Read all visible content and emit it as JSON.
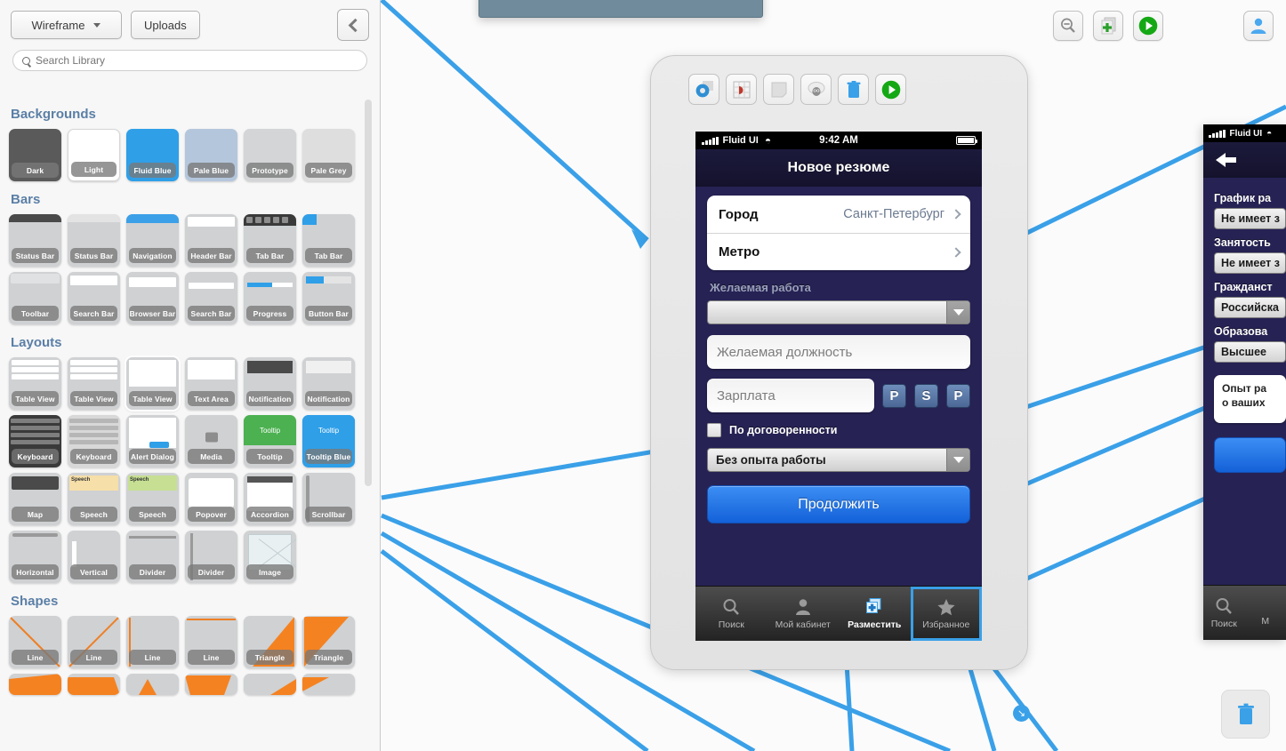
{
  "sidebar": {
    "library_button": "Wireframe",
    "uploads_button": "Uploads",
    "search_placeholder": "Search Library",
    "sections": [
      {
        "title": "Backgrounds",
        "items": [
          {
            "label": "Dark",
            "style": "dark"
          },
          {
            "label": "Light",
            "style": "white"
          },
          {
            "label": "Fluid Blue",
            "style": "blue"
          },
          {
            "label": "Pale Blue",
            "style": "paleblue"
          },
          {
            "label": "Prototype",
            "style": "proto"
          },
          {
            "label": "Pale Grey",
            "style": "palegrey"
          }
        ]
      },
      {
        "title": "Bars",
        "items": [
          {
            "label": "Status Bar",
            "style": "statusbar-dark"
          },
          {
            "label": "Status Bar",
            "style": "statusbar-light"
          },
          {
            "label": "Navigation",
            "style": "navigation"
          },
          {
            "label": "Header Bar",
            "style": "headerbar"
          },
          {
            "label": "Tab Bar",
            "style": "tabbar-dark"
          },
          {
            "label": "Tab Bar",
            "style": "tabbar-blue"
          },
          {
            "label": "Toolbar",
            "style": "toolbar"
          },
          {
            "label": "Search Bar",
            "style": "searchbar1"
          },
          {
            "label": "Browser Bar",
            "style": "browserbar"
          },
          {
            "label": "Search Bar",
            "style": "searchbar2"
          },
          {
            "label": "Progress",
            "style": "progress"
          },
          {
            "label": "Button Bar",
            "style": "buttonbar"
          }
        ]
      },
      {
        "title": "Layouts",
        "items": [
          {
            "label": "Table View",
            "style": "table1"
          },
          {
            "label": "Table View",
            "style": "table2"
          },
          {
            "label": "Table View",
            "style": "table3"
          },
          {
            "label": "Text Area",
            "style": "textarea"
          },
          {
            "label": "Notification",
            "style": "notif-dark"
          },
          {
            "label": "Notification",
            "style": "notif-light"
          },
          {
            "label": "Keyboard",
            "style": "kb-dark"
          },
          {
            "label": "Keyboard",
            "style": "kb-light"
          },
          {
            "label": "Alert Dialog",
            "style": "alert"
          },
          {
            "label": "Media",
            "style": "media"
          },
          {
            "label": "Tooltip",
            "style": "tooltip-green"
          },
          {
            "label": "Tooltip Blue",
            "style": "tooltip-blue"
          },
          {
            "label": "Map",
            "style": "map"
          },
          {
            "label": "Speech",
            "style": "speech-yellow"
          },
          {
            "label": "Speech",
            "style": "speech-green"
          },
          {
            "label": "Popover",
            "style": "popover"
          },
          {
            "label": "Accordion",
            "style": "accordion"
          },
          {
            "label": "Scrollbar",
            "style": "scrollbar"
          },
          {
            "label": "Horizontal",
            "style": "horizontal"
          },
          {
            "label": "Vertical",
            "style": "vertical"
          },
          {
            "label": "Divider",
            "style": "divider-h"
          },
          {
            "label": "Divider",
            "style": "divider-v"
          },
          {
            "label": "Image",
            "style": "image"
          }
        ]
      },
      {
        "title": "Shapes",
        "items": [
          {
            "label": "Line",
            "style": "line-dl"
          },
          {
            "label": "Line",
            "style": "line-ur"
          },
          {
            "label": "Line",
            "style": "line-v"
          },
          {
            "label": "Line",
            "style": "line-h"
          },
          {
            "label": "Triangle",
            "style": "tri-r"
          },
          {
            "label": "Triangle",
            "style": "tri-l"
          }
        ],
        "partial_row": [
          "shape-trap1",
          "shape-trap2",
          "shape-arrow",
          "shape-trap3",
          "shape-tri4",
          "shape-tri5"
        ]
      }
    ]
  },
  "toolbar": {
    "icons": [
      {
        "name": "zoom-out-icon"
      },
      {
        "name": "add-page-icon"
      },
      {
        "name": "play-icon"
      },
      {
        "name": "account-icon"
      }
    ]
  },
  "phone_tools": [
    {
      "name": "settings-gear-icon"
    },
    {
      "name": "transition-icon"
    },
    {
      "name": "duplicate-page-icon"
    },
    {
      "name": "sheep-icon"
    },
    {
      "name": "delete-page-icon"
    },
    {
      "name": "preview-play-icon"
    }
  ],
  "phone": {
    "status": {
      "carrier": "Fluid UI",
      "time": "9:42 AM"
    },
    "title": "Новое резюме",
    "rows": [
      {
        "label": "Город",
        "value": "Санкт-Петербург"
      },
      {
        "label": "Метро",
        "value": ""
      }
    ],
    "section_label": "Желаемая работа",
    "job_select": "",
    "position_placeholder": "Желаемая должность",
    "salary_placeholder": "Зарплата",
    "currency_buttons": [
      "P",
      "S",
      "P"
    ],
    "checkbox_label": "По договоренности",
    "experience_select": "Без опыта работы",
    "cta": "Продолжить",
    "tabs": [
      {
        "label": "Поиск",
        "icon": "search-icon",
        "active": false
      },
      {
        "label": "Мой кабинет",
        "icon": "person-icon",
        "active": false
      },
      {
        "label": "Разместить",
        "icon": "add-doc-icon",
        "active": true
      },
      {
        "label": "Избранное",
        "icon": "star-icon",
        "active": false
      }
    ]
  },
  "phone_right": {
    "status": {
      "carrier": "Fluid UI"
    },
    "fields": [
      {
        "label": "График ра",
        "value": "Не имеет з"
      },
      {
        "label": "Занятость",
        "value": "Не имеет з"
      },
      {
        "label": "Гражданст",
        "value": "Российска"
      },
      {
        "label": "Образова",
        "value": "Высшее"
      }
    ],
    "textarea": "Опыт ра\nо ваших",
    "tabs": [
      {
        "label": "Поиск",
        "icon": "search-icon"
      },
      {
        "label": "М",
        "icon": "person-icon"
      }
    ]
  },
  "canvas": {
    "badge": "↘",
    "trash_icon": "trash-icon"
  }
}
